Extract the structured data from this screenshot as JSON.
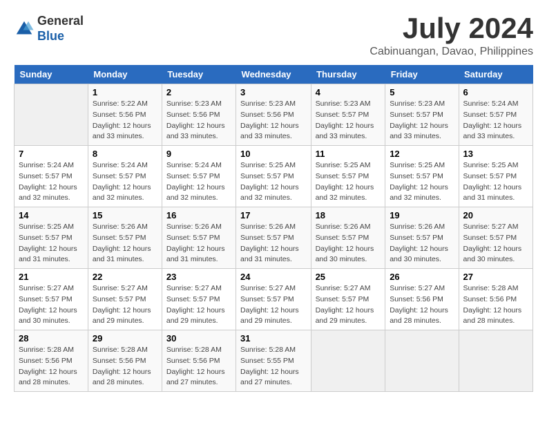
{
  "header": {
    "logo_general": "General",
    "logo_blue": "Blue",
    "month_year": "July 2024",
    "location": "Cabinuangan, Davao, Philippines"
  },
  "calendar": {
    "days_of_week": [
      "Sunday",
      "Monday",
      "Tuesday",
      "Wednesday",
      "Thursday",
      "Friday",
      "Saturday"
    ],
    "weeks": [
      [
        {
          "day": "",
          "empty": true
        },
        {
          "day": "1",
          "sunrise": "Sunrise: 5:22 AM",
          "sunset": "Sunset: 5:56 PM",
          "daylight": "Daylight: 12 hours and 33 minutes."
        },
        {
          "day": "2",
          "sunrise": "Sunrise: 5:23 AM",
          "sunset": "Sunset: 5:56 PM",
          "daylight": "Daylight: 12 hours and 33 minutes."
        },
        {
          "day": "3",
          "sunrise": "Sunrise: 5:23 AM",
          "sunset": "Sunset: 5:56 PM",
          "daylight": "Daylight: 12 hours and 33 minutes."
        },
        {
          "day": "4",
          "sunrise": "Sunrise: 5:23 AM",
          "sunset": "Sunset: 5:57 PM",
          "daylight": "Daylight: 12 hours and 33 minutes."
        },
        {
          "day": "5",
          "sunrise": "Sunrise: 5:23 AM",
          "sunset": "Sunset: 5:57 PM",
          "daylight": "Daylight: 12 hours and 33 minutes."
        },
        {
          "day": "6",
          "sunrise": "Sunrise: 5:24 AM",
          "sunset": "Sunset: 5:57 PM",
          "daylight": "Daylight: 12 hours and 33 minutes."
        }
      ],
      [
        {
          "day": "7",
          "sunrise": "Sunrise: 5:24 AM",
          "sunset": "Sunset: 5:57 PM",
          "daylight": "Daylight: 12 hours and 32 minutes."
        },
        {
          "day": "8",
          "sunrise": "Sunrise: 5:24 AM",
          "sunset": "Sunset: 5:57 PM",
          "daylight": "Daylight: 12 hours and 32 minutes."
        },
        {
          "day": "9",
          "sunrise": "Sunrise: 5:24 AM",
          "sunset": "Sunset: 5:57 PM",
          "daylight": "Daylight: 12 hours and 32 minutes."
        },
        {
          "day": "10",
          "sunrise": "Sunrise: 5:25 AM",
          "sunset": "Sunset: 5:57 PM",
          "daylight": "Daylight: 12 hours and 32 minutes."
        },
        {
          "day": "11",
          "sunrise": "Sunrise: 5:25 AM",
          "sunset": "Sunset: 5:57 PM",
          "daylight": "Daylight: 12 hours and 32 minutes."
        },
        {
          "day": "12",
          "sunrise": "Sunrise: 5:25 AM",
          "sunset": "Sunset: 5:57 PM",
          "daylight": "Daylight: 12 hours and 32 minutes."
        },
        {
          "day": "13",
          "sunrise": "Sunrise: 5:25 AM",
          "sunset": "Sunset: 5:57 PM",
          "daylight": "Daylight: 12 hours and 31 minutes."
        }
      ],
      [
        {
          "day": "14",
          "sunrise": "Sunrise: 5:25 AM",
          "sunset": "Sunset: 5:57 PM",
          "daylight": "Daylight: 12 hours and 31 minutes."
        },
        {
          "day": "15",
          "sunrise": "Sunrise: 5:26 AM",
          "sunset": "Sunset: 5:57 PM",
          "daylight": "Daylight: 12 hours and 31 minutes."
        },
        {
          "day": "16",
          "sunrise": "Sunrise: 5:26 AM",
          "sunset": "Sunset: 5:57 PM",
          "daylight": "Daylight: 12 hours and 31 minutes."
        },
        {
          "day": "17",
          "sunrise": "Sunrise: 5:26 AM",
          "sunset": "Sunset: 5:57 PM",
          "daylight": "Daylight: 12 hours and 31 minutes."
        },
        {
          "day": "18",
          "sunrise": "Sunrise: 5:26 AM",
          "sunset": "Sunset: 5:57 PM",
          "daylight": "Daylight: 12 hours and 30 minutes."
        },
        {
          "day": "19",
          "sunrise": "Sunrise: 5:26 AM",
          "sunset": "Sunset: 5:57 PM",
          "daylight": "Daylight: 12 hours and 30 minutes."
        },
        {
          "day": "20",
          "sunrise": "Sunrise: 5:27 AM",
          "sunset": "Sunset: 5:57 PM",
          "daylight": "Daylight: 12 hours and 30 minutes."
        }
      ],
      [
        {
          "day": "21",
          "sunrise": "Sunrise: 5:27 AM",
          "sunset": "Sunset: 5:57 PM",
          "daylight": "Daylight: 12 hours and 30 minutes."
        },
        {
          "day": "22",
          "sunrise": "Sunrise: 5:27 AM",
          "sunset": "Sunset: 5:57 PM",
          "daylight": "Daylight: 12 hours and 29 minutes."
        },
        {
          "day": "23",
          "sunrise": "Sunrise: 5:27 AM",
          "sunset": "Sunset: 5:57 PM",
          "daylight": "Daylight: 12 hours and 29 minutes."
        },
        {
          "day": "24",
          "sunrise": "Sunrise: 5:27 AM",
          "sunset": "Sunset: 5:57 PM",
          "daylight": "Daylight: 12 hours and 29 minutes."
        },
        {
          "day": "25",
          "sunrise": "Sunrise: 5:27 AM",
          "sunset": "Sunset: 5:57 PM",
          "daylight": "Daylight: 12 hours and 29 minutes."
        },
        {
          "day": "26",
          "sunrise": "Sunrise: 5:27 AM",
          "sunset": "Sunset: 5:56 PM",
          "daylight": "Daylight: 12 hours and 28 minutes."
        },
        {
          "day": "27",
          "sunrise": "Sunrise: 5:28 AM",
          "sunset": "Sunset: 5:56 PM",
          "daylight": "Daylight: 12 hours and 28 minutes."
        }
      ],
      [
        {
          "day": "28",
          "sunrise": "Sunrise: 5:28 AM",
          "sunset": "Sunset: 5:56 PM",
          "daylight": "Daylight: 12 hours and 28 minutes."
        },
        {
          "day": "29",
          "sunrise": "Sunrise: 5:28 AM",
          "sunset": "Sunset: 5:56 PM",
          "daylight": "Daylight: 12 hours and 28 minutes."
        },
        {
          "day": "30",
          "sunrise": "Sunrise: 5:28 AM",
          "sunset": "Sunset: 5:56 PM",
          "daylight": "Daylight: 12 hours and 27 minutes."
        },
        {
          "day": "31",
          "sunrise": "Sunrise: 5:28 AM",
          "sunset": "Sunset: 5:55 PM",
          "daylight": "Daylight: 12 hours and 27 minutes."
        },
        {
          "day": "",
          "empty": true
        },
        {
          "day": "",
          "empty": true
        },
        {
          "day": "",
          "empty": true
        }
      ]
    ]
  }
}
